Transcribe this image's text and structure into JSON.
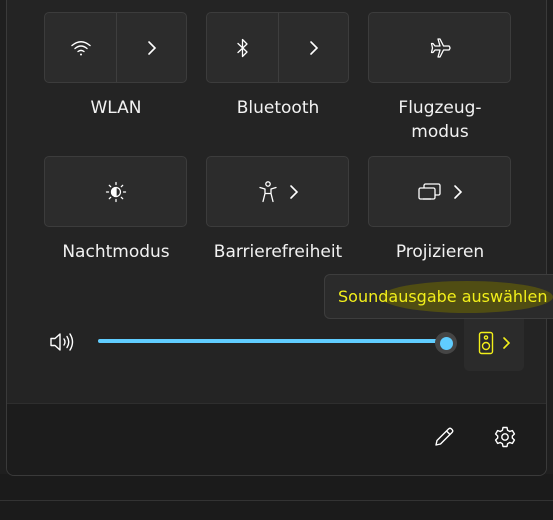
{
  "tiles": [
    {
      "label": "WLAN",
      "icon": "wifi-icon"
    },
    {
      "label": "Bluetooth",
      "icon": "bluetooth-icon"
    },
    {
      "label": "Flugzeug-\nmodus",
      "icon": "airplane-icon"
    },
    {
      "label": "Nachtmodus",
      "icon": "night-light-icon"
    },
    {
      "label": "Barrierefreiheit",
      "icon": "accessibility-icon"
    },
    {
      "label": "Projizieren",
      "icon": "project-icon"
    }
  ],
  "volume": {
    "level": 1.0,
    "icon": "speaker-volume-icon"
  },
  "output_button": {
    "icon": "speaker-device-icon"
  },
  "tooltip": {
    "text": "Soundausgabe auswählen"
  },
  "footer": {
    "edit_icon": "pencil-icon",
    "settings_icon": "gear-icon"
  },
  "colors": {
    "accent": "#60cdff",
    "highlight": "#f2ef1a"
  }
}
